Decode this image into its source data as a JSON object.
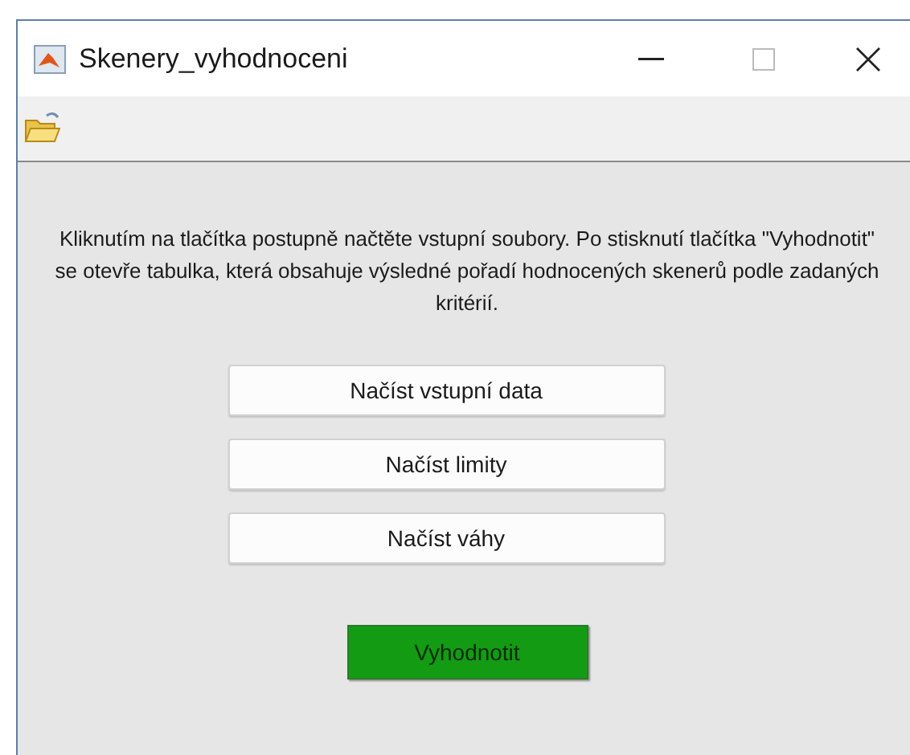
{
  "window": {
    "title": "Skenery_vyhodnoceni"
  },
  "instructions": "Kliknutím na tlačítka postupně načtěte vstupní soubory. Po stisknutí tlačítka \"Vyhodnotit\" se otevře tabulka, která obsahuje výsledné pořadí hodnocených skenerů podle zadaných kritérií.",
  "buttons": [
    {
      "label": "Načíst vstupní data",
      "kind": "plain"
    },
    {
      "label": "Načíst limity",
      "kind": "plain"
    },
    {
      "label": "Načíst váhy",
      "kind": "plain"
    },
    {
      "label": "Vyhodnotit",
      "kind": "primary"
    }
  ]
}
